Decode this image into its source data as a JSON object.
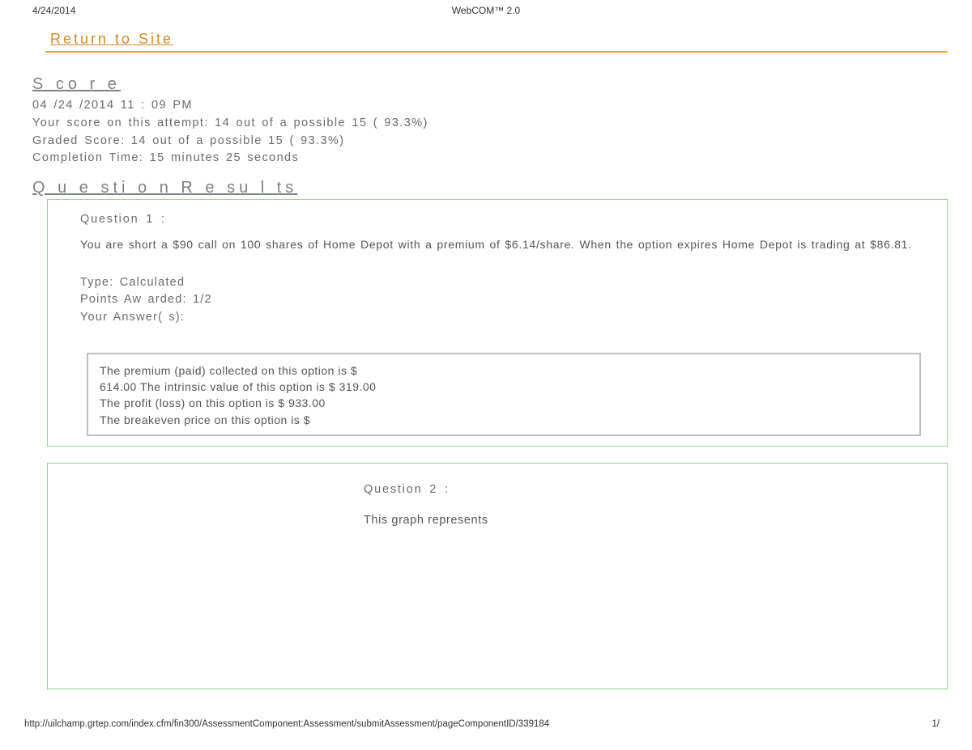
{
  "print_header": {
    "date": "4/24/2014",
    "title": "WebCOM™ 2.0"
  },
  "return_link": "Return to Site",
  "score_section": {
    "heading": "S co r e",
    "timestamp": "04 /24 /2014  11 : 09  PM",
    "your_score": "Your score on this  attempt: 14 out of a possible 15 ( 93.3%)",
    "graded_score": "Graded  Score: 14 out of a possible 15 ( 93.3%)",
    "completion_time": "Completion Time: 15 minutes 25 seconds"
  },
  "question_results_heading": "Q u e sti o n R e su l ts",
  "question1": {
    "title": "Question 1 :",
    "text": "You are short a $90 call on 100 shares of Home Depot with a premium of $6.14/share. When the option expires Home Depot is trading at $86.81.",
    "type_line": "Type: Calculated",
    "points_line": "Points Aw arded: 1/2",
    "your_answers_line": "Your  Answer( s):",
    "answers": {
      "line1": "The premium (paid) collected on this option is $",
      "line2": "614.00 The intrinsic value of this option is $ 319.00",
      "line3": "The profit (loss) on this option is $ 933.00",
      "line4": "The breakeven price on this option is $"
    }
  },
  "question2": {
    "title": "Question 2 :",
    "text": "This graph represents"
  },
  "print_footer": {
    "url": "http://uilchamp.grtep.com/index.cfm/fin300/AssessmentComponent:Assessment/submitAssessment/pageComponentID/339184",
    "page": "1/"
  }
}
